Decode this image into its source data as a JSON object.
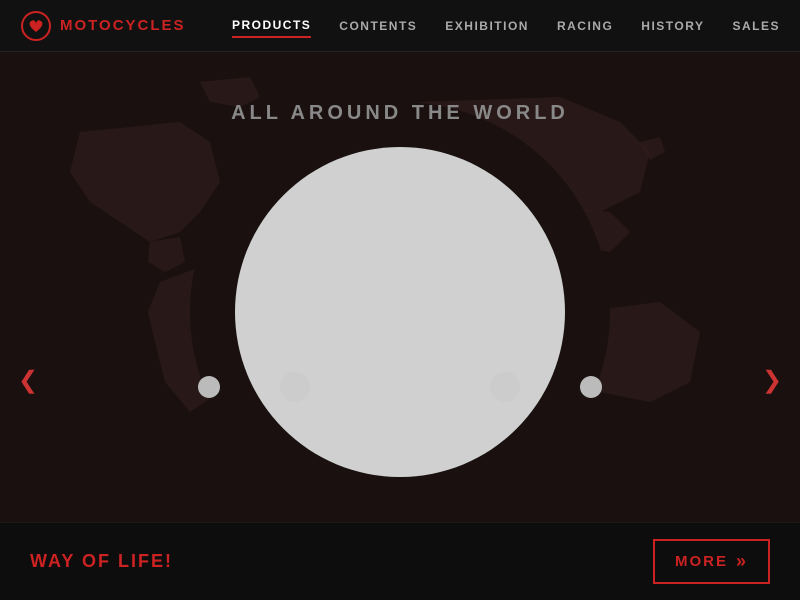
{
  "header": {
    "logo_text": "MOTOCYCLES",
    "nav_items": [
      {
        "label": "PRODUCTS",
        "active": true
      },
      {
        "label": "CONTENTS",
        "active": false
      },
      {
        "label": "EXHIBITION",
        "active": false
      },
      {
        "label": "RACING",
        "active": false
      },
      {
        "label": "HISTORY",
        "active": false
      },
      {
        "label": "SALES",
        "active": false
      }
    ]
  },
  "hero": {
    "title": "ALL AROUND THE WORLD",
    "tagline": "WAY OF LIFE!",
    "more_label": "MORE",
    "chevrons": "»"
  },
  "carousel": {
    "dots": [
      {
        "id": "dot1",
        "active": false
      },
      {
        "id": "dot2",
        "active": false
      },
      {
        "id": "dot3",
        "active": true
      },
      {
        "id": "dot4",
        "active": false
      },
      {
        "id": "dot5",
        "active": false
      }
    ],
    "prev_arrow": "❮",
    "next_arrow": "❯"
  },
  "colors": {
    "accent": "#cc2222",
    "bg_dark": "#0a0a0a",
    "text_muted": "#888888"
  }
}
